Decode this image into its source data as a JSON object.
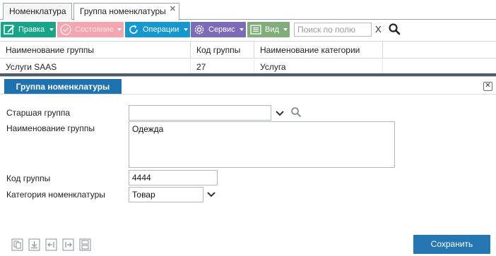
{
  "tabs": [
    {
      "label": "Номенклатура"
    },
    {
      "label": "Группа номенклатуры",
      "close": "✕"
    }
  ],
  "toolbar": {
    "edit": "Правка",
    "state": "Состояние",
    "operations": "Операции",
    "service": "Сервис",
    "view": "Вид",
    "search_placeholder": "Поиск по полю",
    "clear": "X"
  },
  "grid": {
    "columns": [
      "Наименование группы",
      "Код группы",
      "Наименование категории"
    ],
    "rows": [
      [
        "Услуги SAAS",
        "27",
        "Услуга"
      ]
    ]
  },
  "panel": {
    "title": "Группа номенклатуры",
    "close": "✕",
    "fields": {
      "parent_group_label": "Старшая группа",
      "parent_group_value": "",
      "group_name_label": "Наименование группы",
      "group_name_value": "Одежда",
      "group_code_label": "Код группы",
      "group_code_value": "4444",
      "category_label": "Категория номенклатуры",
      "category_value": "Товар"
    },
    "save": "Сохранить"
  },
  "colors": {
    "edit": "#17a589",
    "state": "#f3a6b0",
    "operations": "#1597cf",
    "service": "#7c6bb8",
    "view": "#80ad79",
    "primary": "#2477b3"
  }
}
